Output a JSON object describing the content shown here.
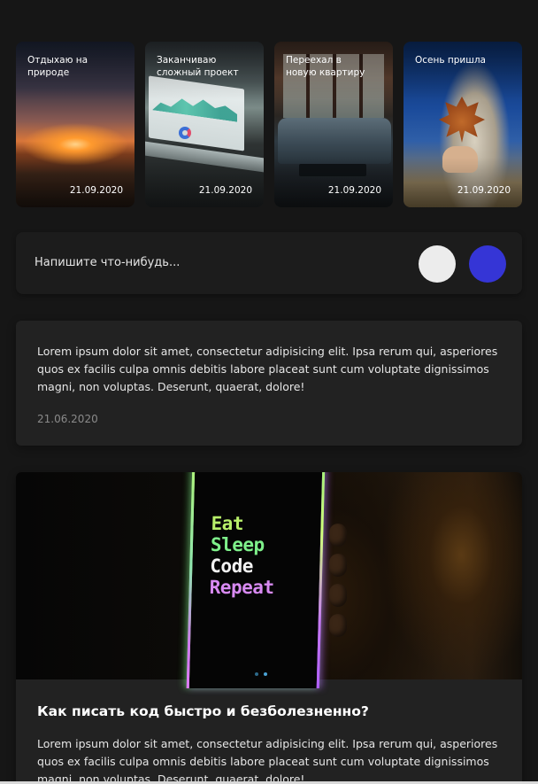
{
  "stories": [
    {
      "title": "Отдыхаю на природе",
      "date": "21.09.2020",
      "image": "sunset"
    },
    {
      "title": "Заканчиваю сложный проект",
      "date": "21.09.2020",
      "image": "laptop"
    },
    {
      "title": "Переехал в новую квартиру",
      "date": "21.09.2020",
      "image": "room"
    },
    {
      "title": "Осень пришла",
      "date": "21.09.2020",
      "image": "autumn-leaf"
    }
  ],
  "composer": {
    "placeholder": "Напишите что-нибудь..."
  },
  "posts": [
    {
      "text": "Lorem ipsum dolor sit amet, consectetur adipisicing elit. Ipsa rerum qui, asperiores quos ex facilis culpa omnis debitis labore placeat sunt cum voluptate dignissimos magni, non voluptas. Deserunt, quaerat, dolore!",
      "date": "21.06.2020"
    },
    {
      "image_text": [
        "Eat",
        "Sleep",
        "Code",
        "Repeat"
      ],
      "title": "Как писать код быстро и безболезненно?",
      "text": "Lorem ipsum dolor sit amet, consectetur adipisicing elit. Ipsa rerum qui, asperiores quos ex facilis culpa omnis debitis labore placeat sunt cum voluptate dignissimos magni, non voluptas. Deserunt, quaerat, dolore!"
    }
  ],
  "colors": {
    "background": "#161616",
    "card": "#222222",
    "accent_blue": "#3535d6",
    "button_white": "#ececec"
  }
}
